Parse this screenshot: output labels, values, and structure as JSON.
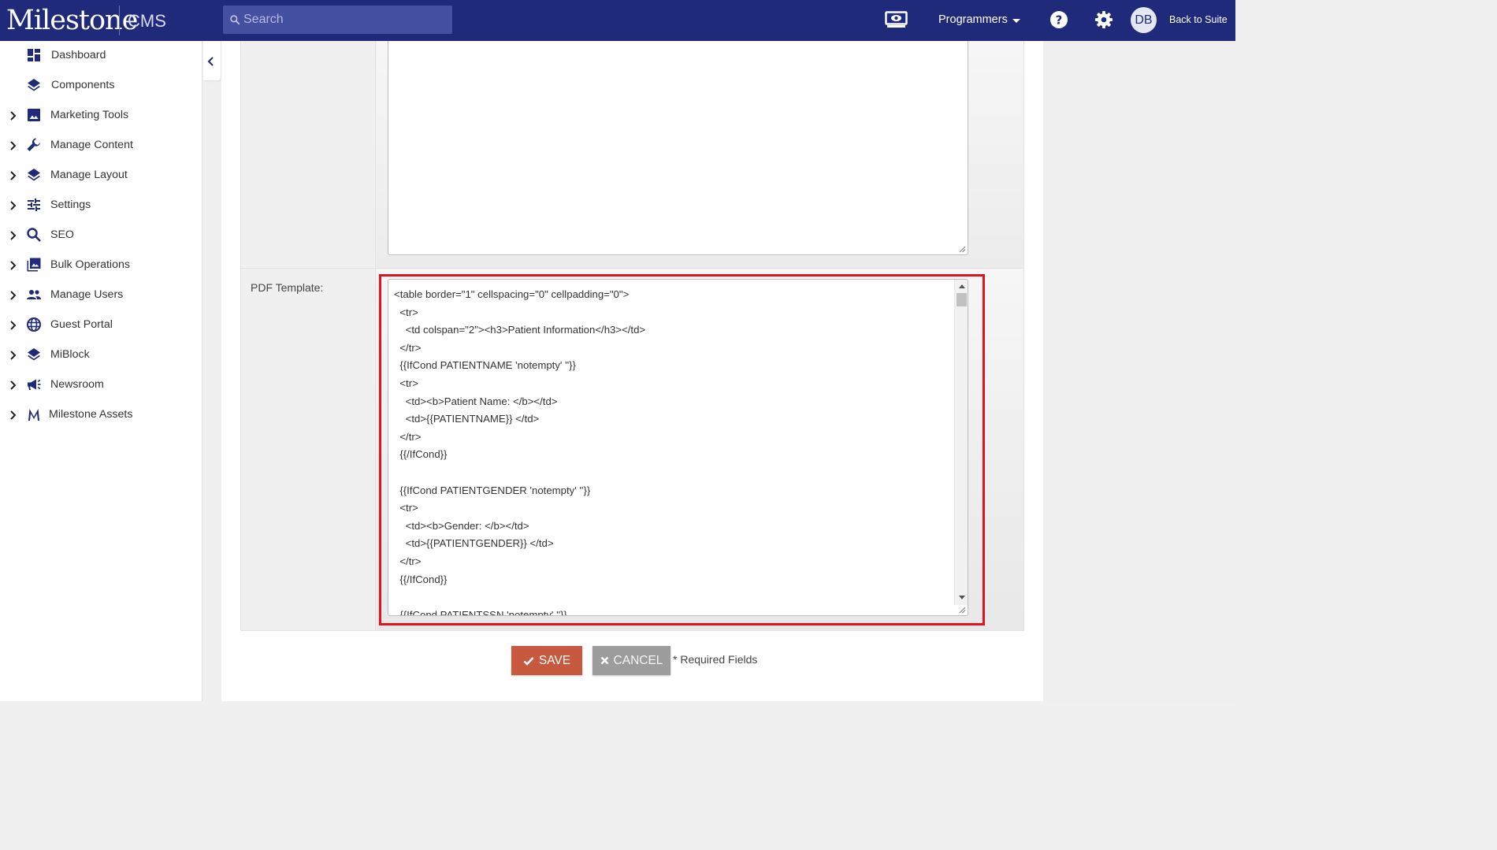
{
  "header": {
    "logo": "Milestone",
    "product": "CMS",
    "search_placeholder": "Search",
    "account_menu": "Programmers",
    "avatar_initials": "DB",
    "back_link": "Back to Suite",
    "icons": [
      "search-icon",
      "preview-icon",
      "help-icon",
      "gear-icon"
    ]
  },
  "sidebar": {
    "items": [
      {
        "label": "Dashboard",
        "icon": "dashboard-icon",
        "expandable": false
      },
      {
        "label": "Components",
        "icon": "layers-icon",
        "expandable": false
      },
      {
        "label": "Marketing Tools",
        "icon": "image-icon",
        "expandable": true
      },
      {
        "label": "Manage Content",
        "icon": "wrench-icon",
        "expandable": true
      },
      {
        "label": "Manage Layout",
        "icon": "layers-icon",
        "expandable": true
      },
      {
        "label": "Settings",
        "icon": "sliders-icon",
        "expandable": true
      },
      {
        "label": "SEO",
        "icon": "search-icon",
        "expandable": true
      },
      {
        "label": "Bulk Operations",
        "icon": "photo-library-icon",
        "expandable": true
      },
      {
        "label": "Manage Users",
        "icon": "people-icon",
        "expandable": true
      },
      {
        "label": "Guest Portal",
        "icon": "globe-icon",
        "expandable": true
      },
      {
        "label": "MiBlock",
        "icon": "layers-icon",
        "expandable": true
      },
      {
        "label": "Newsroom",
        "icon": "megaphone-icon",
        "expandable": true
      },
      {
        "label": "Milestone Assets",
        "icon": "milestone-m-icon",
        "expandable": true
      }
    ]
  },
  "form": {
    "pdf_label": "PDF Template:",
    "pdf_template_lines": [
      "<table border=\"1\" cellspacing=\"0\" cellpadding=\"0\">",
      "  <tr>",
      "    <td colspan=\"2\"><h3>Patient Information</h3></td>",
      "  </tr>",
      "  {{IfCond PATIENTNAME 'notempty' ''}}",
      "  <tr>",
      "    <td><b>Patient Name: </b></td>",
      "    <td>{{PATIENTNAME}} </td>",
      "  </tr>",
      "  {{/IfCond}}",
      "",
      "  {{IfCond PATIENTGENDER 'notempty' ''}}",
      "  <tr>",
      "    <td><b>Gender: </b></td>",
      "    <td>{{PATIENTGENDER}} </td>",
      "  </tr>",
      "  {{/IfCond}}",
      "",
      "  {{IfCond PATIENTSSN 'notempty' ''}}"
    ]
  },
  "actions": {
    "save_label": "SAVE",
    "cancel_label": "CANCEL",
    "required_note": "* Required Fields"
  },
  "colors": {
    "header_bg": "#1f2a7a",
    "save_bg": "#c7593f",
    "cancel_bg": "#9c9c9c",
    "highlight_border": "#e0141e",
    "nav_icon": "#1f2a7a"
  }
}
